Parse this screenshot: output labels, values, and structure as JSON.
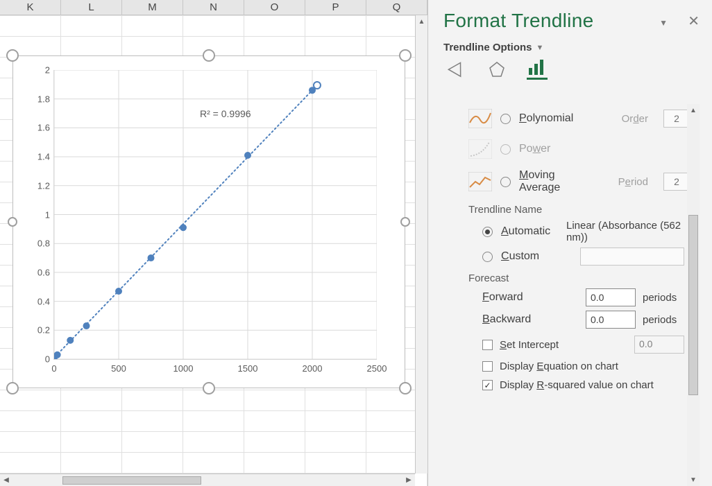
{
  "sheet": {
    "columns": [
      "K",
      "L",
      "M",
      "N",
      "O",
      "P",
      "Q"
    ]
  },
  "chart_data": {
    "type": "scatter",
    "x": [
      0,
      25,
      125,
      250,
      500,
      750,
      1000,
      1500,
      2000
    ],
    "y": [
      0.01,
      0.03,
      0.13,
      0.23,
      0.47,
      0.7,
      0.91,
      1.41,
      1.86
    ],
    "xlim": [
      0,
      2500
    ],
    "ylim": [
      0,
      2
    ],
    "x_ticks": [
      0,
      500,
      1000,
      1500,
      2000,
      2500
    ],
    "y_ticks": [
      0,
      0.2,
      0.4,
      0.6,
      0.8,
      1,
      1.2,
      1.4,
      1.6,
      1.8,
      2
    ],
    "trendline": {
      "type": "linear",
      "r2_label": "R² = 0.9996"
    }
  },
  "pane": {
    "title": "Format Trendline",
    "subtitle": "Trendline Options",
    "type_options": {
      "polynomial": {
        "label": "Polynomial",
        "order_label": "Order",
        "order_value": "2",
        "enabled": true
      },
      "power": {
        "label": "Power",
        "enabled": false
      },
      "moving_avg": {
        "label": "Moving Average",
        "period_label": "Period",
        "period_value": "2",
        "enabled": true
      }
    },
    "name": {
      "section": "Trendline Name",
      "automatic_label": "Automatic",
      "automatic_value": "Linear (Absorbance (562 nm))",
      "custom_label": "Custom"
    },
    "forecast": {
      "section": "Forecast",
      "forward_label": "Forward",
      "forward_value": "0.0",
      "backward_label": "Backward",
      "backward_value": "0.0",
      "unit": "periods"
    },
    "set_intercept": {
      "label": "Set Intercept",
      "value": "0.0",
      "checked": false
    },
    "display_eq": {
      "label": "Display Equation on chart",
      "checked": false
    },
    "display_r2": {
      "label": "Display R-squared value on chart",
      "checked": true
    }
  }
}
